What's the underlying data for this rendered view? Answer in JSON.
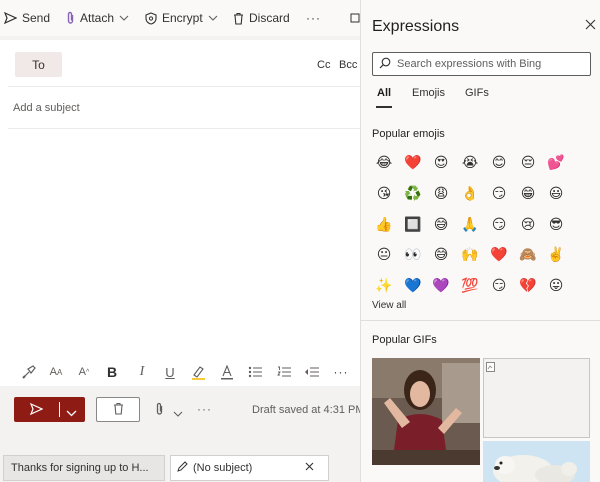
{
  "toolbar": {
    "send_label": "Send",
    "attach_label": "Attach",
    "encrypt_label": "Encrypt",
    "discard_label": "Discard",
    "more_label": "···"
  },
  "compose": {
    "to_label": "To",
    "cc_label": "Cc",
    "bcc_label": "Bcc",
    "subject_placeholder": "Add a subject",
    "draft_status": "Draft saved at 4:31 PM",
    "more_label": "···"
  },
  "format": {
    "more_label": "···"
  },
  "tabs": [
    {
      "label": "Thanks for signing up to H..."
    },
    {
      "label": "(No subject)"
    }
  ],
  "expressions": {
    "title": "Expressions",
    "search_placeholder": "Search expressions with Bing",
    "tabs": [
      "All",
      "Emojis",
      "GIFs"
    ],
    "popular_emojis_label": "Popular emojis",
    "view_all_label": "View all",
    "popular_gifs_label": "Popular GIFs",
    "emoji_rows": [
      [
        "😂",
        "❤️",
        "😍",
        "😭",
        "😊",
        "😔",
        "💕"
      ],
      [
        "😘",
        "♻️",
        "😩",
        "👌",
        "😏",
        "😁",
        "😃"
      ],
      [
        "👍",
        "🔲",
        "😅",
        "🙏",
        "😏",
        "😢",
        "😎"
      ],
      [
        "😐",
        "👀",
        "😅",
        "🙌",
        "❤️",
        "🙈",
        "✌️"
      ],
      [
        "✨",
        "💙",
        "💜",
        "💯",
        "😏",
        "💔",
        "😛"
      ]
    ]
  },
  "colors": {
    "accent": "#8e1b14",
    "tab_underline": "#323130",
    "panel_bg": "#faf9f8"
  }
}
